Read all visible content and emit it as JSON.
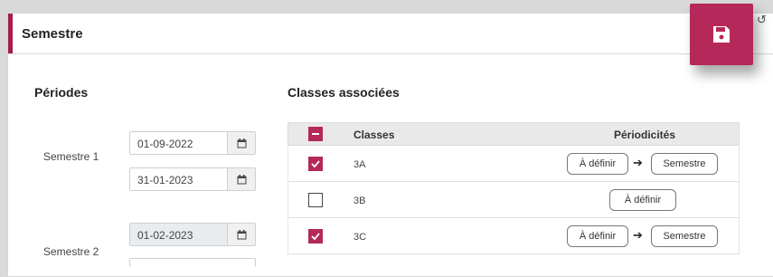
{
  "header": {
    "title": "Semestre",
    "save_icon": "floppy-disk-icon",
    "undo_icon": "undo-icon"
  },
  "colors": {
    "accent": "#b5285a"
  },
  "periods": {
    "title": "Périodes",
    "items": [
      {
        "label": "Semestre 1",
        "start": "01-09-2022",
        "end": "31-01-2023"
      },
      {
        "label": "Semestre 2",
        "start": "01-02-2023"
      }
    ]
  },
  "classes": {
    "title": "Classes associées",
    "headers": {
      "classes": "Classes",
      "periodicities": "Périodicités"
    },
    "rows": [
      {
        "name": "3A",
        "checked": true,
        "from": "À définir",
        "to": "Semestre"
      },
      {
        "name": "3B",
        "checked": false,
        "from": "À définir"
      },
      {
        "name": "3C",
        "checked": true,
        "from": "À définir",
        "to": "Semestre"
      }
    ]
  }
}
